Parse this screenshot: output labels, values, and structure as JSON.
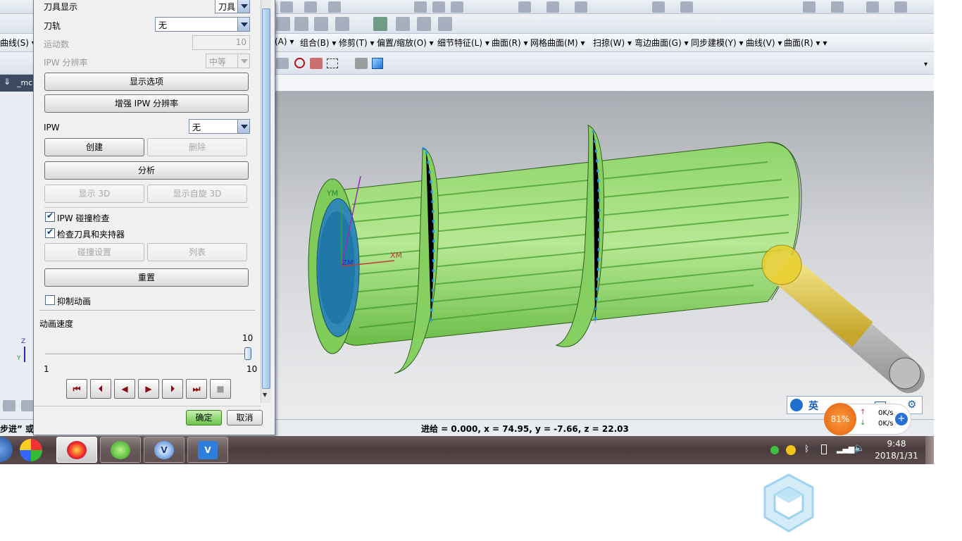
{
  "app": {
    "menubar": {
      "partial_left": "曲线(S) ▾",
      "partial_mid": "(A) ▾",
      "items": [
        "组合(B) ▾",
        "修剪(T) ▾",
        "偏置/缩放(O) ▾",
        "细节特征(L) ▾",
        "曲面(R) ▾",
        "网格曲面(M) ▾",
        "扫掠(W) ▾",
        "弯边曲面(G) ▾",
        "同步建模(Y) ▾",
        "曲线(V) ▾",
        "曲面(R) ▾ ▾"
      ]
    },
    "nav_tab_label": "_mc",
    "status_left": "步进” 或",
    "status_main": "进给 = 0.000, x = 74.95, y = -7.66, z = 22.03",
    "axis": {
      "z": "Z",
      "y": "Y",
      "ym": "YM",
      "xm": "XM",
      "zm": "ZM"
    }
  },
  "dialog": {
    "tool_display_label": "刀具显示",
    "tool_display_value": "刀具",
    "toolpath_label": "刀轨",
    "toolpath_value": "无",
    "motion_count_label": "运动数",
    "motion_count_value": "10",
    "ipw_resolution_label": "IPW 分辨率",
    "ipw_resolution_value": "中等",
    "btn_display_options": "显示选项",
    "btn_enhance_ipw": "增强 IPW 分辨率",
    "ipw_label": "IPW",
    "ipw_value": "无",
    "btn_create": "创建",
    "btn_delete": "删除",
    "btn_analyze": "分析",
    "btn_show_3d": "显示 3D",
    "btn_show_spin_3d": "显示自旋 3D",
    "chk_ipw_collision": "IPW 碰撞检查",
    "chk_tool_holder": "检查刀具和夹持器",
    "btn_collision_settings": "碰撞设置",
    "btn_list": "列表",
    "btn_reset": "重置",
    "chk_suppress_animation": "抑制动画",
    "animation_speed_label": "动画速度",
    "slider_value_label": "10",
    "slider_min_label": "1",
    "slider_max_label": "10",
    "animation_speed_value": 10,
    "btn_ok": "确定",
    "btn_cancel": "取消"
  },
  "tray": {
    "ime_label": "英",
    "battery_pct": "81%",
    "net_up": "0K/s",
    "net_down": "0K/s",
    "time": "9:48",
    "date": "2018/1/31"
  }
}
